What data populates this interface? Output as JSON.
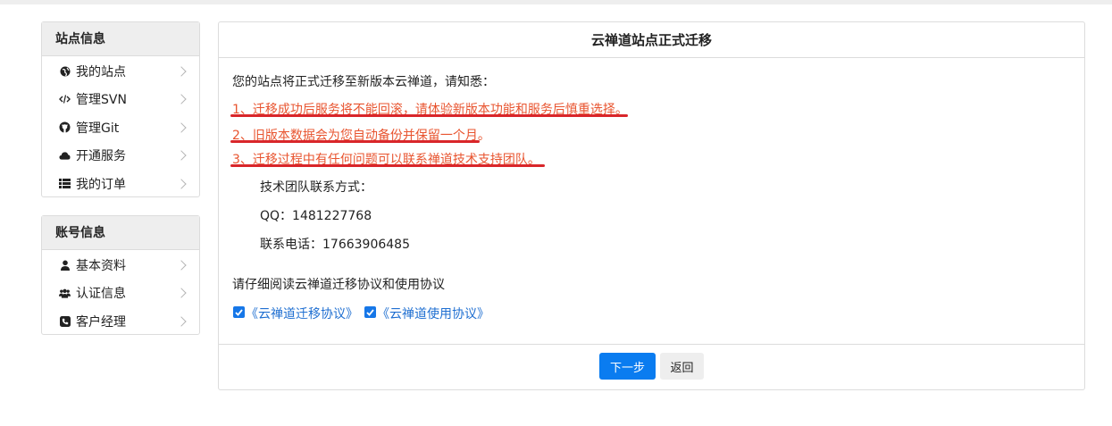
{
  "sidebar": {
    "site_panel": {
      "title": "站点信息",
      "items": [
        {
          "label": "我的站点",
          "icon": "globe-icon"
        },
        {
          "label": "管理SVN",
          "icon": "code-icon"
        },
        {
          "label": "管理Git",
          "icon": "github-icon"
        },
        {
          "label": "开通服务",
          "icon": "cloud-icon"
        },
        {
          "label": "我的订单",
          "icon": "list-icon"
        }
      ]
    },
    "account_panel": {
      "title": "账号信息",
      "items": [
        {
          "label": "基本资料",
          "icon": "user-icon"
        },
        {
          "label": "认证信息",
          "icon": "users-icon"
        },
        {
          "label": "客户经理",
          "icon": "phone-icon"
        }
      ]
    }
  },
  "main": {
    "title": "云禅道站点正式迁移",
    "intro": "您的站点将正式迁移至新版本云禅道，请知悉：",
    "notices": [
      "1、迁移成功后服务将不能回滚，请体验新版本功能和服务后慎重选择。",
      "2、旧版本数据会为您自动备份并保留一个月。",
      "3、迁移过程中有任何问题可以联系禅道技术支持团队。"
    ],
    "contact_title": "技术团队联系方式：",
    "qq": "QQ：1481227768",
    "phone": "联系电话：17663906485",
    "agreement_prompt": "请仔细阅读云禅道迁移协议和使用协议",
    "agreements": [
      "《云禅道迁移协议》",
      "《云禅道使用协议》"
    ],
    "next_label": "下一步",
    "back_label": "返回"
  },
  "colors": {
    "accent": "#0a7cf0",
    "notice": "#e8542f",
    "underline": "#d9262a",
    "link": "#1f6fd1"
  }
}
